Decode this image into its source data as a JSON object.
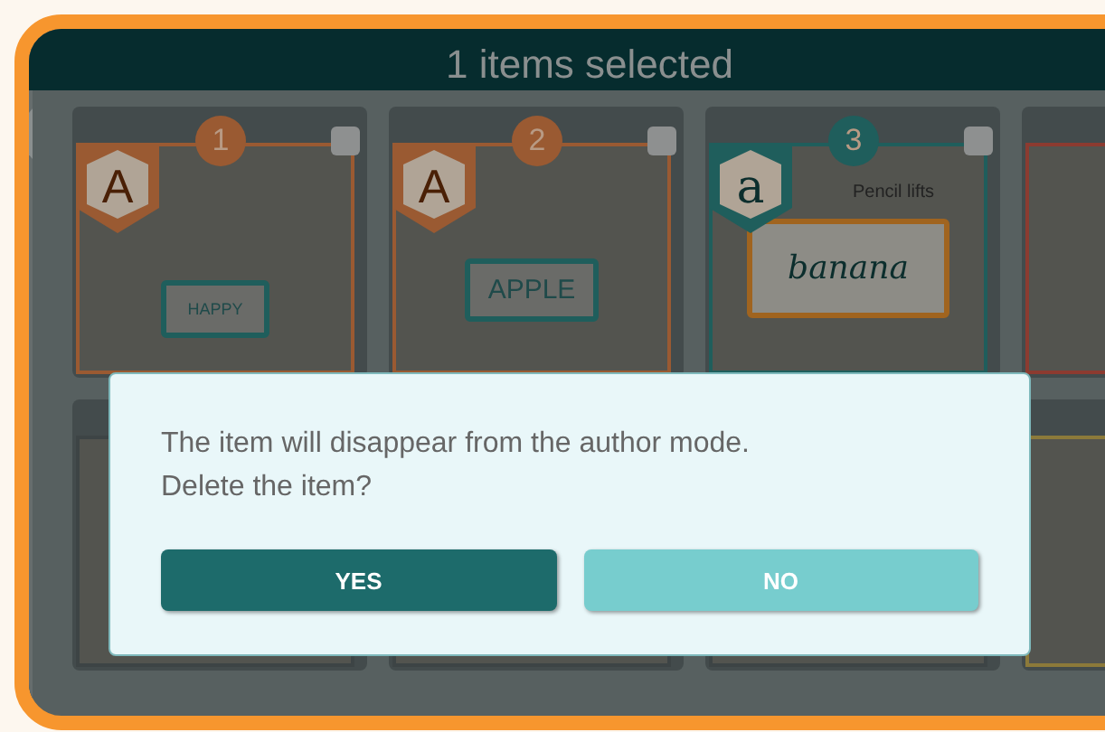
{
  "header": {
    "title": "1 items selected"
  },
  "cards": [
    {
      "kind": "print",
      "number": "1",
      "letter": "A",
      "word": "HAPPY",
      "color": "#9a5a32",
      "checked": false
    },
    {
      "kind": "print",
      "number": "2",
      "letter": "A",
      "word": "APPLE",
      "color": "#9a5a32",
      "checked": false
    },
    {
      "kind": "cursive",
      "number": "3",
      "letter": "a",
      "caption": "Pencil lifts",
      "word": "banana",
      "color": "#1f5e5c",
      "checked": false
    },
    {
      "kind": "blank",
      "color": "#8c3b30"
    },
    {
      "kind": "blank"
    },
    {
      "kind": "blank"
    },
    {
      "kind": "blank"
    },
    {
      "kind": "blank",
      "color": "#8c7a3a"
    }
  ],
  "dialog": {
    "message": "The item will disappear from the author mode.",
    "question": "Delete the item?",
    "buttons": [
      {
        "label": "YES",
        "kind": "primary"
      },
      {
        "label": "NO",
        "kind": "secondary"
      }
    ]
  }
}
